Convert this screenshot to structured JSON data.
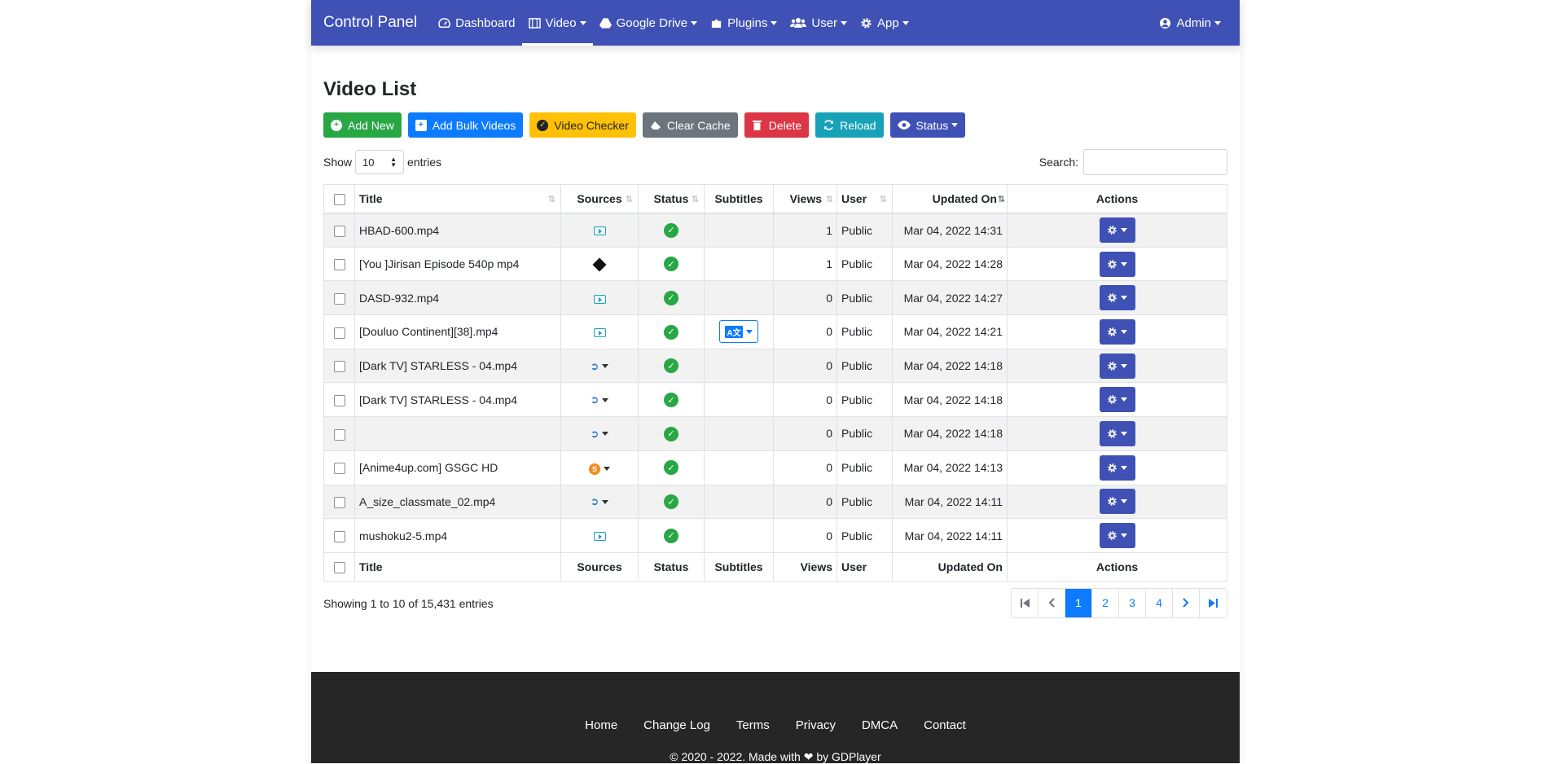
{
  "navbar": {
    "brand": "Control Panel",
    "items": [
      {
        "label": "Dashboard",
        "icon": "dashboard-icon"
      },
      {
        "label": "Video",
        "icon": "film-icon"
      },
      {
        "label": "Google Drive",
        "icon": "google-drive-icon"
      },
      {
        "label": "Plugins",
        "icon": "puzzle-icon"
      },
      {
        "label": "User",
        "icon": "users-icon"
      },
      {
        "label": "App",
        "icon": "gear-icon"
      }
    ],
    "account": {
      "label": "Admin",
      "icon": "user-circle-icon"
    }
  },
  "page": {
    "title": "Video List"
  },
  "toolbar": {
    "add_new": "Add New",
    "add_bulk": "Add Bulk Videos",
    "video_checker": "Video Checker",
    "clear_cache": "Clear Cache",
    "delete": "Delete",
    "reload": "Reload",
    "status": "Status"
  },
  "length": {
    "show_label": "Show",
    "value": "10",
    "entries_label": "entries"
  },
  "search": {
    "label": "Search:"
  },
  "table": {
    "headers": [
      "Title",
      "Sources",
      "Status",
      "Subtitles",
      "Views",
      "User",
      "Updated On",
      "Actions"
    ],
    "rows": [
      {
        "title": "HBAD-600.mp4",
        "source": "video",
        "views": "1",
        "user": "Public",
        "updated": "Mar 04, 2022 14:31",
        "subtitle": false
      },
      {
        "title": "[You ]Jirisan Episode 540p mp4",
        "source": "diamond",
        "views": "1",
        "user": "Public",
        "updated": "Mar 04, 2022 14:28",
        "subtitle": false
      },
      {
        "title": "DASD-932.mp4",
        "source": "video",
        "views": "0",
        "user": "Public",
        "updated": "Mar 04, 2022 14:27",
        "subtitle": false
      },
      {
        "title": "[Douluo Continent][38].mp4",
        "source": "video",
        "views": "0",
        "user": "Public",
        "updated": "Mar 04, 2022 14:21",
        "subtitle": true
      },
      {
        "title": "[Dark TV] STARLESS - 04.mp4",
        "source": "blue",
        "views": "0",
        "user": "Public",
        "updated": "Mar 04, 2022 14:18",
        "subtitle": false
      },
      {
        "title": "[Dark TV] STARLESS - 04.mp4",
        "source": "blue",
        "views": "0",
        "user": "Public",
        "updated": "Mar 04, 2022 14:18",
        "subtitle": false
      },
      {
        "title": "",
        "source": "blue",
        "views": "0",
        "user": "Public",
        "updated": "Mar 04, 2022 14:18",
        "subtitle": false
      },
      {
        "title": "[Anime4up.com] GSGC HD",
        "source": "orange",
        "views": "0",
        "user": "Public",
        "updated": "Mar 04, 2022 14:13",
        "subtitle": false
      },
      {
        "title": "A_size_classmate_02.mp4",
        "source": "blue",
        "views": "0",
        "user": "Public",
        "updated": "Mar 04, 2022 14:11",
        "subtitle": false
      },
      {
        "title": "mushoku2-5.mp4",
        "source": "video",
        "views": "0",
        "user": "Public",
        "updated": "Mar 04, 2022 14:11",
        "subtitle": false
      }
    ]
  },
  "info": "Showing 1 to 10 of 15,431 entries",
  "pagination": [
    "1",
    "2",
    "3",
    "4"
  ],
  "footer": {
    "links": [
      "Home",
      "Change Log",
      "Terms",
      "Privacy",
      "DMCA",
      "Contact"
    ],
    "copyright": "© 2020 - 2022. Made with ❤ by GDPlayer"
  },
  "colors": {
    "primary": "#3f51b5",
    "success": "#28a745",
    "info": "#17a2b8",
    "danger": "#dc3545",
    "warning": "#ffc107",
    "link": "#0d7bff"
  }
}
